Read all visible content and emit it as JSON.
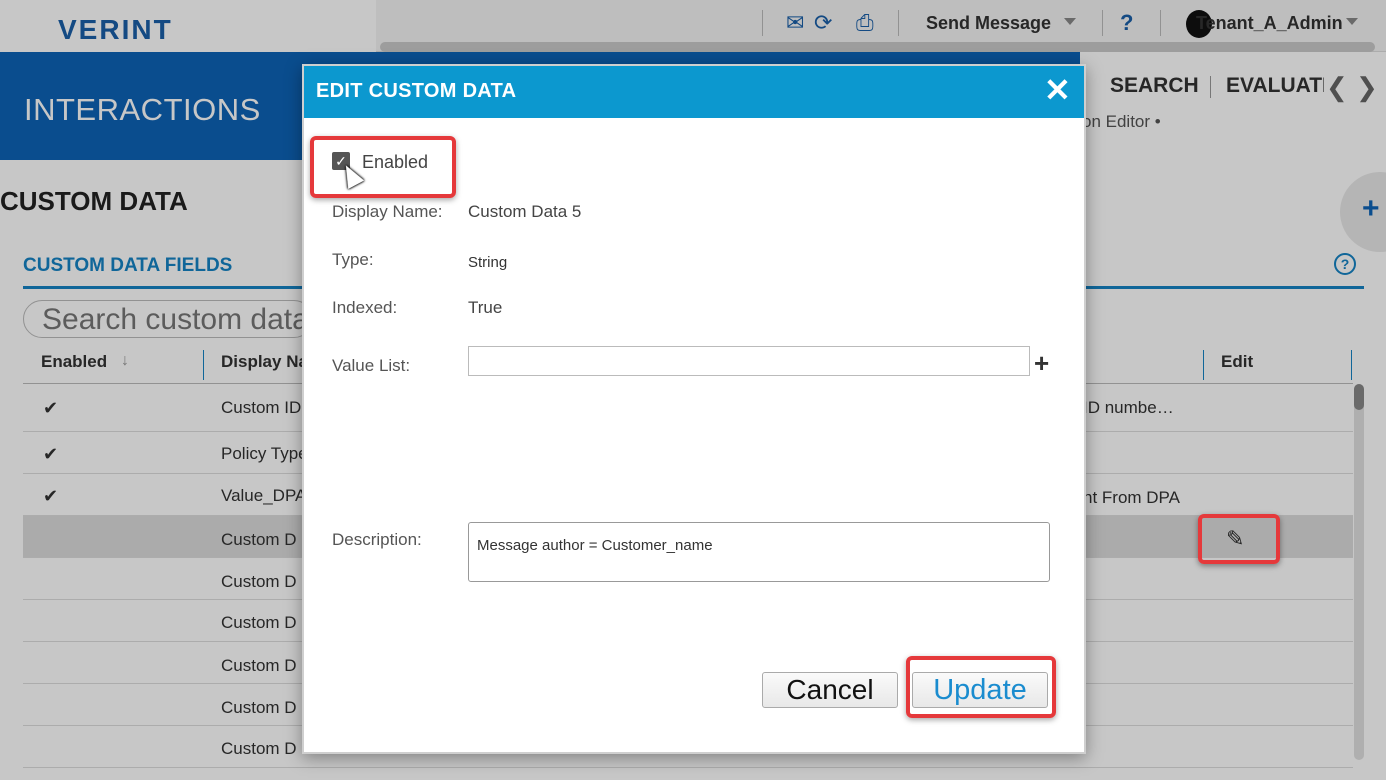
{
  "app": {
    "logo": "VERINT",
    "toolbar": {
      "send_message_label": "Send Message",
      "help_label": "?",
      "user_name": "Tenant_A_Admin"
    },
    "nav": {
      "section_title": "INTERACTIONS",
      "search_tab": "SEARCH",
      "evaluate_tab": "EVALUATE",
      "prev_arrow": "❮",
      "next_arrow": "❯",
      "sub_item": "on Editor  •"
    },
    "page": {
      "title": "CUSTOM DATA",
      "section_title": "CUSTOM DATA FIELDS",
      "search_placeholder": "Search custom data",
      "add_label": "+"
    },
    "grid": {
      "headers": {
        "enabled": "Enabled",
        "sort_indicator": "↓",
        "display_name": "Display Name",
        "edit": "Edit"
      },
      "rows": [
        {
          "check": "✔",
          "name": "Custom ID",
          "desc": "ID numbe…"
        },
        {
          "check": "✔",
          "name": "Policy Type",
          "desc": ""
        },
        {
          "check": "✔",
          "name": "Value_DPA",
          "desc": "nt From DPA"
        },
        {
          "check": "",
          "name": "Custom D",
          "desc": ""
        },
        {
          "check": "",
          "name": "Custom D",
          "desc": ""
        },
        {
          "check": "",
          "name": "Custom D",
          "desc": ""
        },
        {
          "check": "",
          "name": "Custom D",
          "desc": ""
        },
        {
          "check": "",
          "name": "Custom D",
          "desc": ""
        },
        {
          "check": "",
          "name": "Custom D",
          "desc": ""
        }
      ]
    }
  },
  "modal": {
    "title": "EDIT CUSTOM DATA",
    "close_label": "✕",
    "enabled_label": "Enabled",
    "enabled_checked": true,
    "fields": {
      "display_name_label": "Display Name:",
      "display_name_value": "Custom Data 5",
      "type_label": "Type:",
      "type_value": "String",
      "indexed_label": "Indexed:",
      "indexed_value": "True",
      "value_list_label": "Value List:",
      "value_list_value": "",
      "description_label": "Description:",
      "description_value": "Message author = Customer_name"
    },
    "buttons": {
      "cancel": "Cancel",
      "update": "Update"
    }
  },
  "colors": {
    "brand_blue": "#0e63b6",
    "modal_header": "#0c98cf",
    "highlight_red": "#e5393b",
    "accent": "#1583c5"
  },
  "icons": [
    "envelope-icon",
    "refresh-icon",
    "print-icon",
    "help-icon",
    "avatar-icon",
    "plus-icon",
    "close-icon",
    "pencil-icon",
    "checkmark-icon",
    "cursor-icon"
  ]
}
